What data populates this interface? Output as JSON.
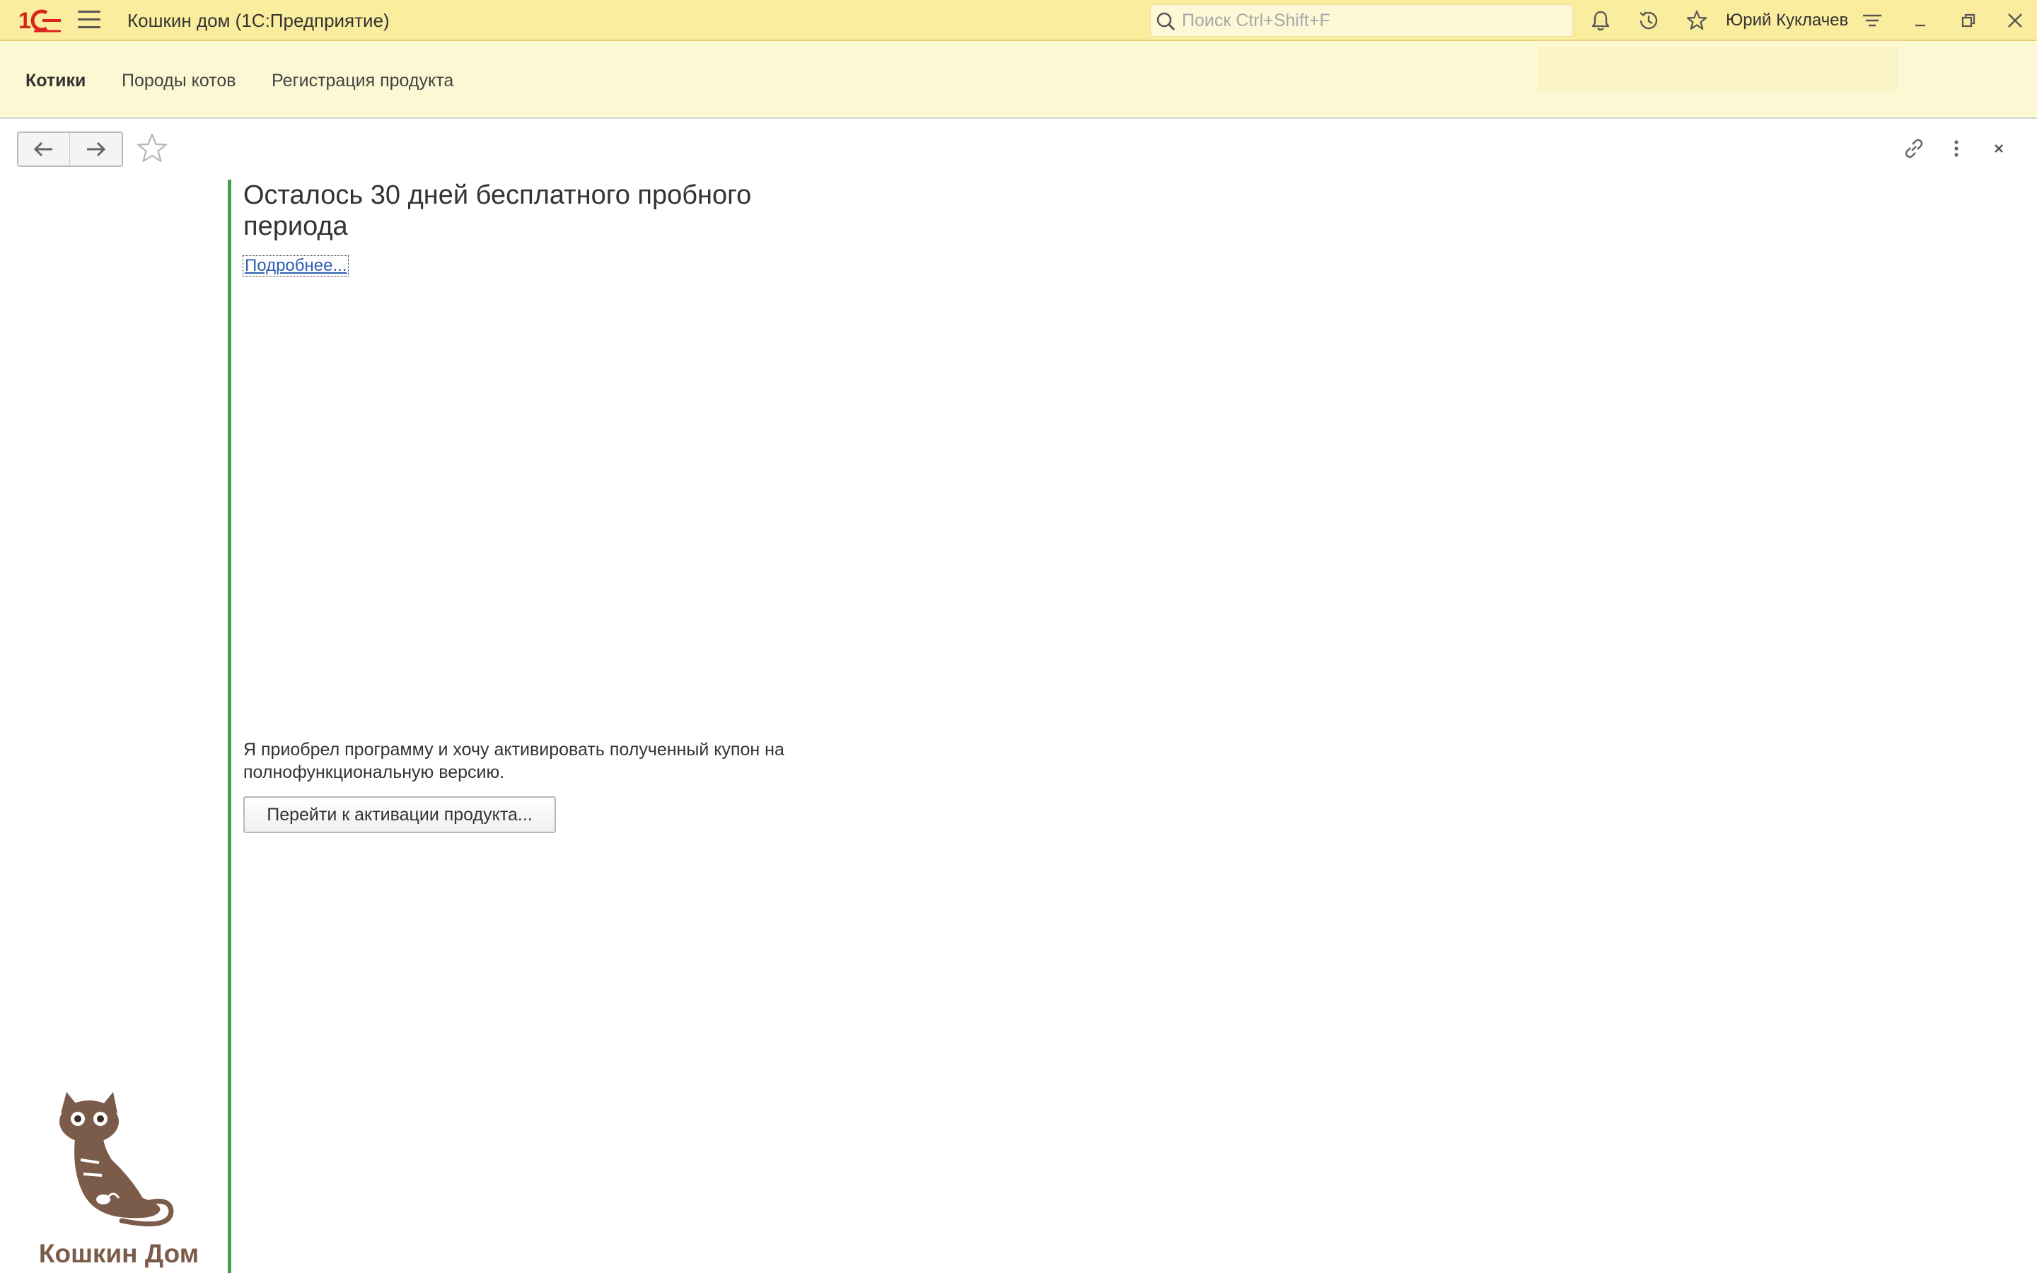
{
  "titlebar": {
    "app_title": "Кошкин дом  (1С:Предприятие)",
    "search_placeholder": "Поиск Ctrl+Shift+F",
    "user_name": "Юрий Куклачев",
    "accent_color": "#fbed9e"
  },
  "sections": {
    "items": [
      {
        "label": "Котики",
        "active": true
      },
      {
        "label": "Породы котов",
        "active": false
      },
      {
        "label": "Регистрация продукта",
        "active": false
      }
    ],
    "background_color": "#fcf8d3"
  },
  "brand": {
    "name": "Кошкин Дом",
    "color": "#7b5b49"
  },
  "content": {
    "headline": "Осталось 30 дней бесплатного пробного периода",
    "more_link": "Подробнее...",
    "coupon_text": "Я приобрел программу и хочу активировать полученный купон на полнофункциональную версию.",
    "activate_button": "Перейти к активации продукта..."
  },
  "icons": {
    "titlebar": [
      "1c-logo-icon",
      "hamburger-menu-icon",
      "search-icon",
      "bell-icon",
      "history-icon",
      "favorites-star-icon",
      "function-menu-icon",
      "minimize-icon",
      "restore-icon",
      "close-window-icon"
    ],
    "form": [
      "back-arrow-icon",
      "forward-arrow-icon",
      "add-to-favorites-icon",
      "link-icon",
      "more-actions-icon",
      "close-form-icon"
    ]
  },
  "colors": {
    "divider_green": "#4a9c4e",
    "link_blue": "#2f5eb1"
  }
}
